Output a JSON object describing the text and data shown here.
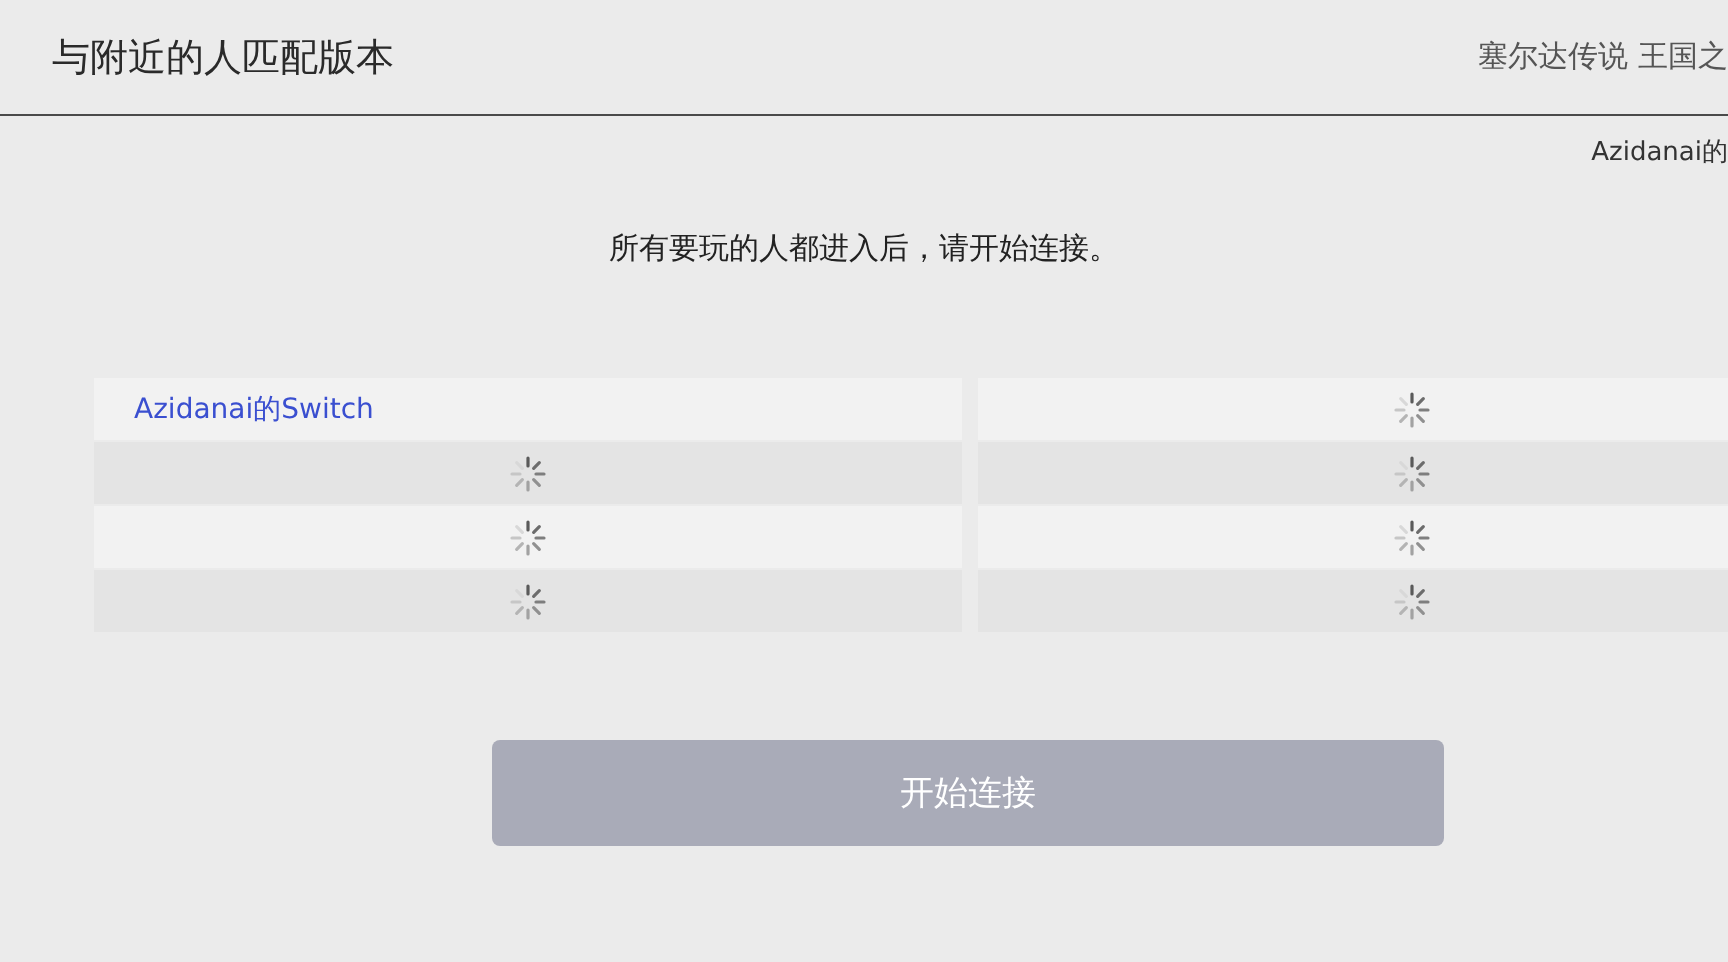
{
  "header": {
    "title": "与附近的人匹配版本",
    "game_title": "塞尔达传说 王国之"
  },
  "user_label": "Azidanai的",
  "prompt": "所有要玩的人都进入后，请开始连接。",
  "columns": [
    {
      "slots": [
        {
          "kind": "player",
          "name": "Azidanai的Switch"
        },
        {
          "kind": "waiting"
        },
        {
          "kind": "waiting"
        },
        {
          "kind": "waiting"
        }
      ]
    },
    {
      "slots": [
        {
          "kind": "waiting"
        },
        {
          "kind": "waiting"
        },
        {
          "kind": "waiting"
        },
        {
          "kind": "waiting"
        }
      ]
    }
  ],
  "start_button": {
    "label": "开始连接",
    "disabled": true
  }
}
